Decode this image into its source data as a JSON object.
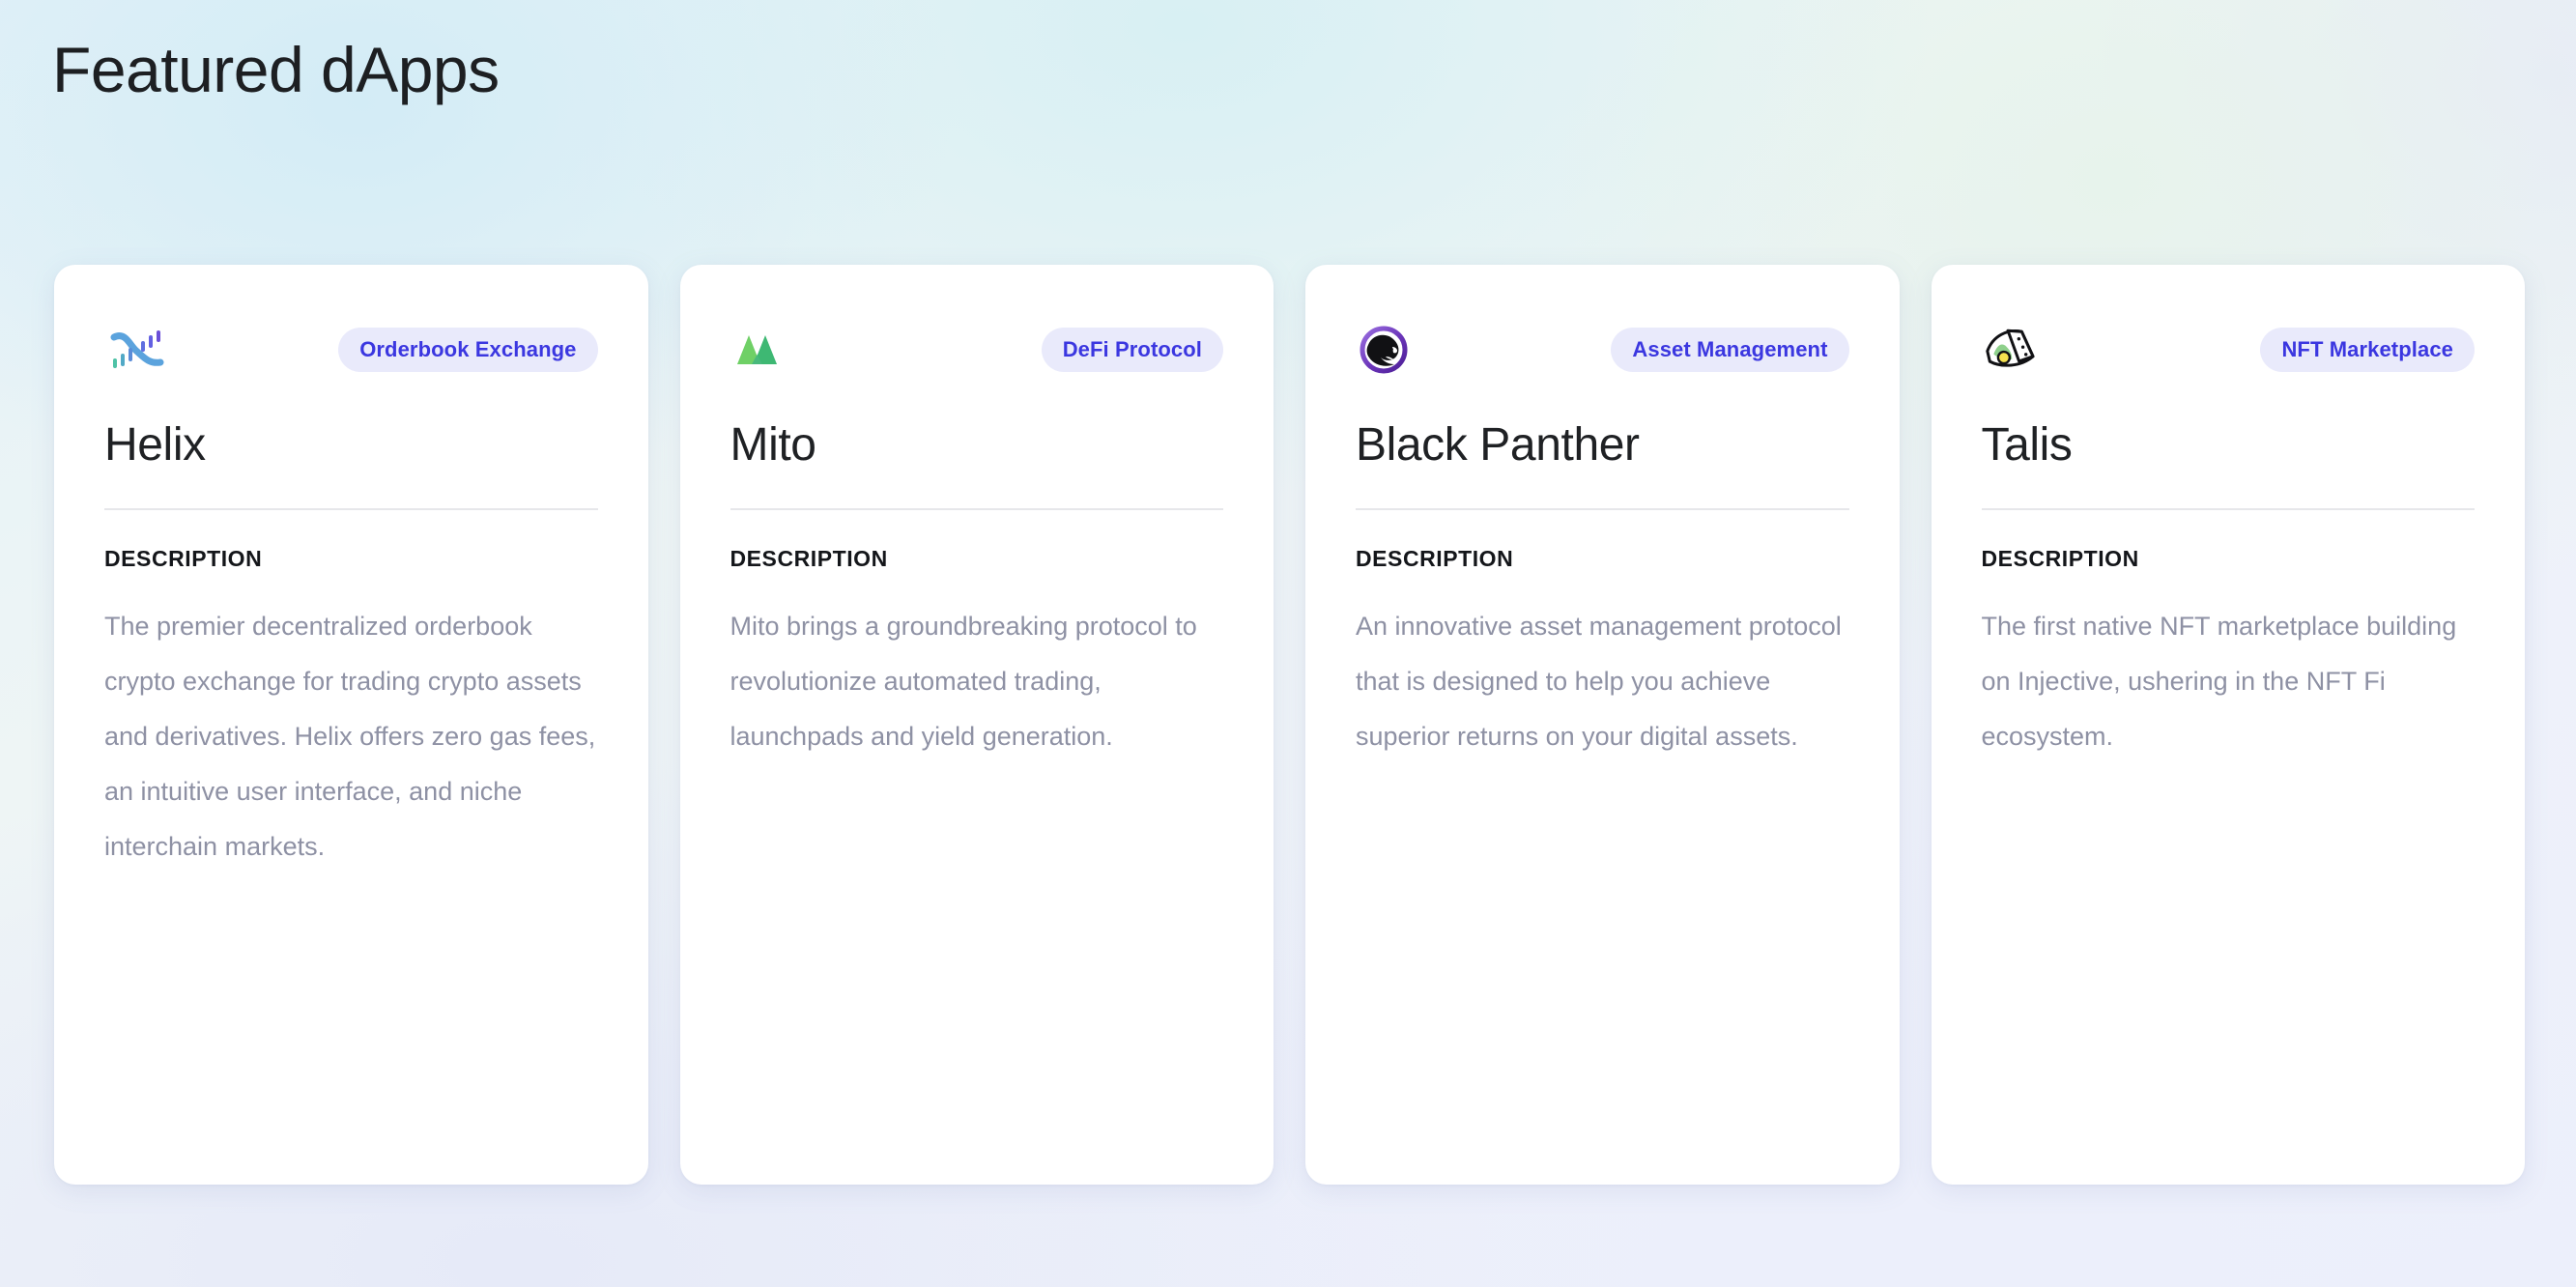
{
  "page": {
    "title": "Featured dApps",
    "background_from": "#e3f1f8",
    "background_to": "#eceffb"
  },
  "labels": {
    "description_heading": "DESCRIPTION"
  },
  "theme": {
    "card_background": "#ffffff",
    "badge_background": "#e9eafb",
    "badge_text_color": "#3b37e0",
    "title_color": "#1f2124",
    "description_color": "#8e91a4",
    "divider_color": "#e6e7ea"
  },
  "cards": [
    {
      "icon_name": "helix-logo-icon",
      "badge": "Orderbook Exchange",
      "title": "Helix",
      "description_label": "DESCRIPTION",
      "description": "The premier decentralized orderbook crypto exchange for trading crypto assets and derivatives. Helix offers zero gas fees, an intuitive user interface, and niche interchain markets.",
      "icon_colors": [
        "#5ba3dd",
        "#4ec2a6",
        "#5f6fe0",
        "#6b4fd8"
      ]
    },
    {
      "icon_name": "mito-logo-icon",
      "badge": "DeFi Protocol",
      "title": "Mito",
      "description_label": "DESCRIPTION",
      "description": "Mito brings a groundbreaking protocol to revolutionize automated trading, launchpads and yield generation.",
      "icon_colors": [
        "#6fd066",
        "#3eb873",
        "#49b97c"
      ]
    },
    {
      "icon_name": "black-panther-logo-icon",
      "badge": "Asset Management",
      "title": "Black Panther",
      "description_label": "DESCRIPTION",
      "description": "An innovative asset management protocol that is designed to help you achieve superior returns on your digital assets.",
      "icon_colors": [
        "#8a5fd6",
        "#5b2fa8",
        "#111114"
      ]
    },
    {
      "icon_name": "talis-logo-icon",
      "badge": "NFT Marketplace",
      "title": "Talis",
      "description_label": "DESCRIPTION",
      "description": "The first native NFT marketplace building on Injective, ushering in the NFT Fi ecosystem.",
      "icon_colors": [
        "#111114",
        "#8ed08b",
        "#f5e14f"
      ]
    }
  ]
}
